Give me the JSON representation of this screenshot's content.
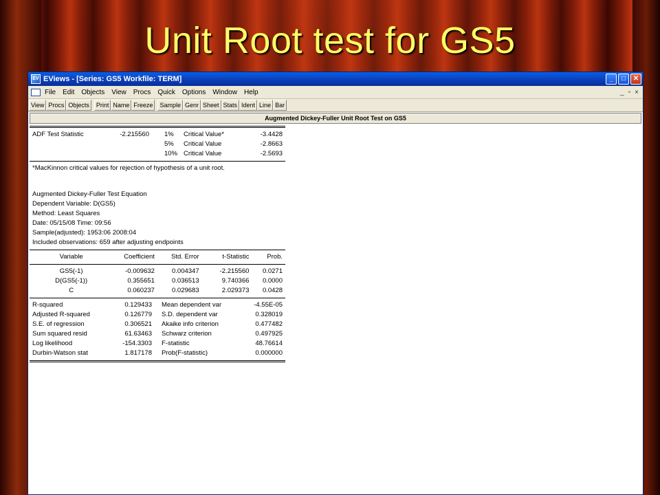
{
  "slide": {
    "title": "Unit Root test for GS5"
  },
  "window": {
    "title": "EViews - [Series: GS5   Workfile: TERM]",
    "icon_label": "EV",
    "min": "_",
    "max": "□",
    "close": "✕"
  },
  "menu": {
    "items": [
      "File",
      "Edit",
      "Objects",
      "View",
      "Procs",
      "Quick",
      "Options",
      "Window",
      "Help"
    ],
    "right": [
      "_",
      "▫",
      "×"
    ]
  },
  "toolbar": {
    "group1": [
      "View",
      "Procs",
      "Objects"
    ],
    "group2": [
      "Print",
      "Name",
      "Freeze"
    ],
    "group3": [
      "Sample",
      "Genr",
      "Sheet",
      "Stats",
      "Ident",
      "Line",
      "Bar"
    ]
  },
  "output": {
    "header": "Augmented Dickey-Fuller Unit Root Test on GS5",
    "adf": {
      "label": "ADF Test Statistic",
      "value": "-2.215560",
      "criticals": [
        {
          "level": "1%",
          "label": "Critical Value*",
          "value": "-3.4428"
        },
        {
          "level": "5%",
          "label": "Critical Value",
          "value": "-2.8663"
        },
        {
          "level": "10%",
          "label": "Critical Value",
          "value": "-2.5693"
        }
      ]
    },
    "note": "*MacKinnon critical values for rejection of hypothesis of a unit root.",
    "equation_info": [
      "Augmented Dickey-Fuller Test Equation",
      "Dependent Variable: D(GS5)",
      "Method: Least Squares",
      "Date: 05/15/08   Time: 09:56",
      "Sample(adjusted): 1953:06 2008:04",
      "Included observations: 659 after adjusting endpoints"
    ],
    "coef_headers": [
      "Variable",
      "Coefficient",
      "Std. Error",
      "t-Statistic",
      "Prob."
    ],
    "coef_rows": [
      [
        "GS5(-1)",
        "-0.009632",
        "0.004347",
        "-2.215560",
        "0.0271"
      ],
      [
        "D(GS5(-1))",
        "0.355651",
        "0.036513",
        "9.740366",
        "0.0000"
      ],
      [
        "C",
        "0.060237",
        "0.029683",
        "2.029373",
        "0.0428"
      ]
    ],
    "stats_rows": [
      [
        "R-squared",
        "0.129433",
        "Mean dependent var",
        "-4.55E-05"
      ],
      [
        "Adjusted R-squared",
        "0.126779",
        "S.D. dependent var",
        "0.328019"
      ],
      [
        "S.E. of regression",
        "0.306521",
        "Akaike info criterion",
        "0.477482"
      ],
      [
        "Sum squared resid",
        "61.63463",
        "Schwarz criterion",
        "0.497925"
      ],
      [
        "Log likelihood",
        "-154.3303",
        "F-statistic",
        "48.76614"
      ],
      [
        "Durbin-Watson stat",
        "1.817178",
        "Prob(F-statistic)",
        "0.000000"
      ]
    ]
  }
}
